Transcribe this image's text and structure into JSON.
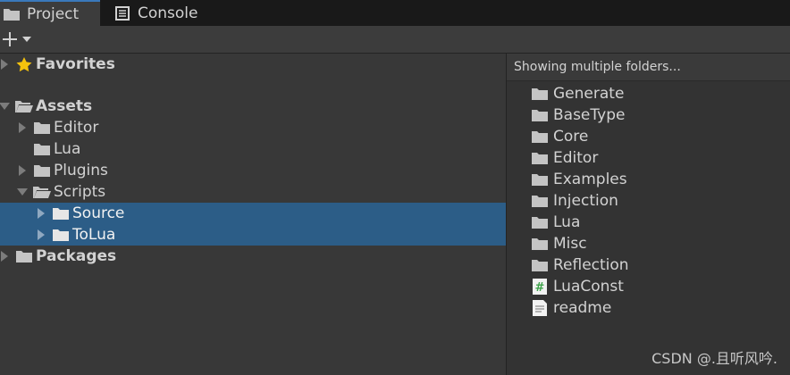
{
  "tabs": {
    "project": "Project",
    "console": "Console"
  },
  "left_tree": {
    "favorites": "Favorites",
    "assets": "Assets",
    "editor": "Editor",
    "lua": "Lua",
    "plugins": "Plugins",
    "scripts": "Scripts",
    "source": "Source",
    "tolua": "ToLua",
    "packages": "Packages"
  },
  "right_panel": {
    "header": "Showing multiple folders...",
    "items": [
      "Generate",
      "BaseType",
      "Core",
      "Editor",
      "Examples",
      "Injection",
      "Lua",
      "Misc",
      "Reflection",
      "LuaConst",
      "readme"
    ]
  },
  "footer": "CSDN @.且听风吟.",
  "colors": {
    "selection": "#2c5d87",
    "tab_accent": "#3a79bb",
    "star": "#f4c20d",
    "script_icon": "#3ea34a"
  }
}
